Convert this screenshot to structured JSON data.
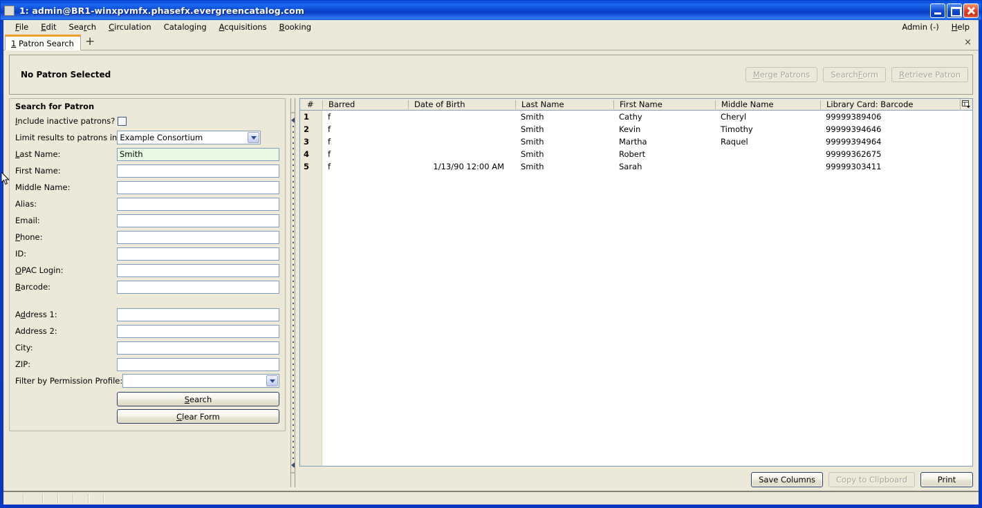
{
  "window": {
    "title": "1: admin@BR1-winxpvmfx.phasefx.evergreencatalog.com",
    "minimize_label": "Minimize",
    "maximize_label": "Maximize",
    "close_label": "Close"
  },
  "menubar": {
    "items": [
      {
        "label": "File",
        "accel": "F"
      },
      {
        "label": "Edit",
        "accel": "E"
      },
      {
        "label": "Search",
        "accel": "r"
      },
      {
        "label": "Circulation",
        "accel": "C"
      },
      {
        "label": "Cataloging",
        "accel": "g"
      },
      {
        "label": "Acquisitions",
        "accel": "A"
      },
      {
        "label": "Booking",
        "accel": "B"
      }
    ],
    "right_items": [
      {
        "label": "Admin (-)"
      },
      {
        "label": "Help",
        "accel": "H"
      }
    ]
  },
  "tabs": {
    "active": "1 Patron Search",
    "new_tab_label": "+",
    "close_label": "×"
  },
  "patron_header": {
    "label": "No Patron Selected",
    "buttons": [
      {
        "label": "Merge Patrons",
        "enabled": false
      },
      {
        "label": "Search Form",
        "enabled": false
      },
      {
        "label": "Retrieve Patron",
        "enabled": false
      }
    ]
  },
  "search_form": {
    "group_title": "Search for Patron",
    "include_inactive": {
      "label": "Include inactive patrons?",
      "checked": false
    },
    "limit_results": {
      "label": "Limit results to patrons in",
      "value": "Example Consortium"
    },
    "fields": [
      {
        "label": "Last Name:",
        "value": "Smith",
        "focused": true,
        "placeholder": ""
      },
      {
        "label": "First Name:",
        "value": "",
        "focused": false,
        "placeholder": ""
      },
      {
        "label": "Middle Name:",
        "value": "",
        "focused": false,
        "placeholder": ""
      },
      {
        "label": "Alias:",
        "value": "",
        "focused": false,
        "placeholder": ""
      },
      {
        "label": "Email:",
        "value": "",
        "focused": false,
        "placeholder": ""
      },
      {
        "label": "Phone:",
        "value": "",
        "focused": false,
        "placeholder": ""
      },
      {
        "label": "ID:",
        "value": "",
        "focused": false,
        "placeholder": ""
      },
      {
        "label": "OPAC Login:",
        "value": "",
        "focused": false,
        "placeholder": ""
      },
      {
        "label": "Barcode:",
        "value": "",
        "focused": false,
        "placeholder": ""
      }
    ],
    "address_fields": [
      {
        "label": "Address 1:",
        "value": "",
        "placeholder": ""
      },
      {
        "label": "Address 2:",
        "value": "",
        "placeholder": ""
      },
      {
        "label": "City:",
        "value": "",
        "placeholder": ""
      },
      {
        "label": "ZIP:",
        "value": "",
        "placeholder": ""
      }
    ],
    "permission_profile": {
      "label": "Filter by Permission Profile:",
      "value": ""
    },
    "search_button": "Search",
    "clear_button": "Clear Form"
  },
  "results": {
    "columns": [
      "#",
      "Barred",
      "Date of Birth",
      "Last Name",
      "First Name",
      "Middle Name",
      "Library Card: Barcode"
    ],
    "rows": [
      {
        "num": "1",
        "barred": "f",
        "dob": "",
        "last": "Smith",
        "first": "Cathy",
        "middle": "Cheryl",
        "card": "99999389406"
      },
      {
        "num": "2",
        "barred": "f",
        "dob": "",
        "last": "Smith",
        "first": "Kevin",
        "middle": "Timothy",
        "card": "99999394646"
      },
      {
        "num": "3",
        "barred": "f",
        "dob": "",
        "last": "Smith",
        "first": "Martha",
        "middle": "Raquel",
        "card": "99999394964"
      },
      {
        "num": "4",
        "barred": "f",
        "dob": "",
        "last": "Smith",
        "first": "Robert",
        "middle": "",
        "card": "99999362675"
      },
      {
        "num": "5",
        "barred": "f",
        "dob": "1/13/90 12:00 AM",
        "last": "Smith",
        "first": "Sarah",
        "middle": "",
        "card": "99999303411"
      }
    ],
    "footer_buttons": [
      {
        "label": "Save Columns",
        "enabled": true
      },
      {
        "label": "Copy to Clipboard",
        "enabled": false
      },
      {
        "label": "Print",
        "enabled": true
      }
    ],
    "column_picker_tooltip": "Column picker"
  },
  "colors": {
    "titlebar_blue": "#0b4fdc",
    "window_bg": "#ece9d8",
    "tab_accent": "#f0a02a",
    "focused_field_bg": "#e8fae4",
    "field_border": "#7f9db9"
  }
}
